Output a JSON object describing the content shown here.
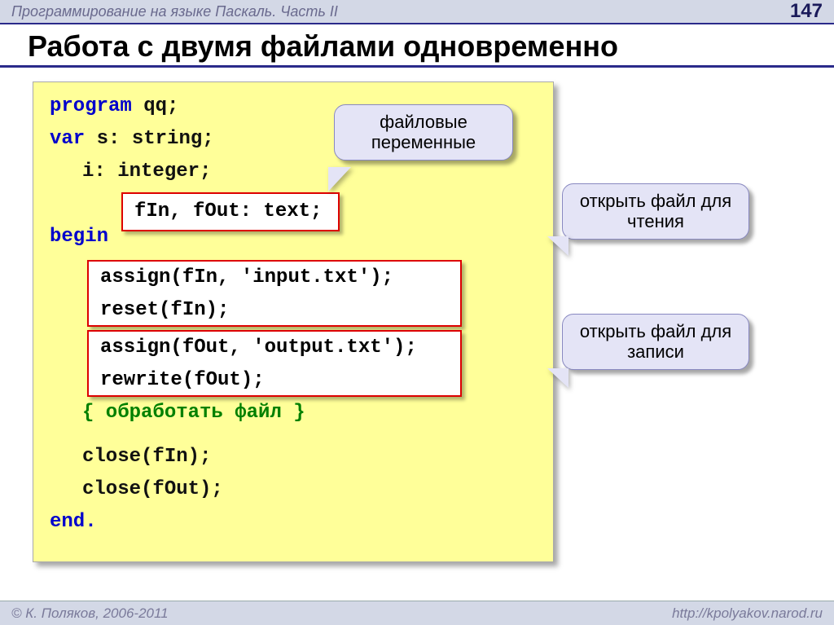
{
  "header": {
    "course": "Программирование на языке Паскаль. Часть II",
    "page": "147"
  },
  "title": "Работа с двумя файлами одновременно",
  "code": {
    "l1a": "program",
    "l1b": " qq;",
    "l2a": "var",
    "l2b": " s: string;",
    "l3": "i: integer;",
    "l4": "fIn, fOut: text;",
    "l5": "begin",
    "l6": "assign(fIn, 'input.txt');",
    "l7": "reset(fIn);",
    "l8": "assign(fOut, 'output.txt');",
    "l9": "rewrite(fOut);",
    "l10": "{ обработать файл }",
    "l11": "close(fIn);",
    "l12": "close(fOut);",
    "l13": "end."
  },
  "callouts": {
    "vars": "файловые переменные",
    "read": "открыть файл для чтения",
    "write": "открыть файл для записи"
  },
  "footer": {
    "author": "© К. Поляков, 2006-2011",
    "url": "http://kpolyakov.narod.ru"
  }
}
